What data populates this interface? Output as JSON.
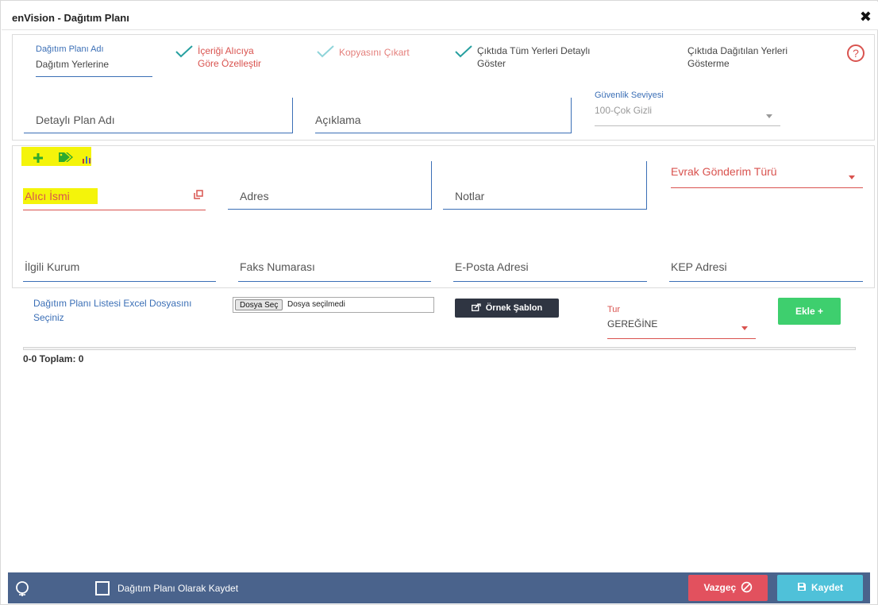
{
  "window": {
    "title": "enVision - Dağıtım Planı"
  },
  "top": {
    "plan_name_label": "Dağıtım Planı Adı",
    "plan_name_value": "Dağıtım Yerlerine",
    "opt1_line1": "İçeriği Alıcıya",
    "opt1_line2": "Göre Özelleştir",
    "opt2": "Kopyasını Çıkart",
    "opt3_line1": "Çıktıda Tüm Yerleri Detaylı",
    "opt3_line2": "Göster",
    "opt4_line1": "Çıktıda Dağıtılan Yerleri",
    "opt4_line2": "Gösterme",
    "help": "?",
    "detail_plan_placeholder": "Detaylı Plan Adı",
    "description_placeholder": "Açıklama",
    "security_label": "Güvenlik Seviyesi",
    "security_value": "100-Çok Gizli"
  },
  "recipient": {
    "name_placeholder": "Alıcı İsmi",
    "address_placeholder": "Adres",
    "notes_placeholder": "Notlar",
    "send_type_placeholder": "Evrak Gönderim Türü",
    "institution_placeholder": "İlgili Kurum",
    "fax_placeholder": "Faks Numarası",
    "email_placeholder": "E-Posta Adresi",
    "kep_placeholder": "KEP Adresi"
  },
  "excel": {
    "label_line1": "Dağıtım Planı Listesi Excel Dosyasını",
    "label_line2": "Seçiniz",
    "file_button": "Dosya Seç",
    "file_status": "Dosya seçilmedi",
    "template_button": "Örnek Şablon",
    "type_label": "Tur",
    "type_value": "GEREĞİNE",
    "add_button": "Ekle +"
  },
  "list": {
    "total": "0-0 Toplam: 0"
  },
  "footer": {
    "save_as_plan": "Dağıtım Planı Olarak Kaydet",
    "cancel": "Vazgeç",
    "save": "Kaydet"
  },
  "colors": {
    "accent_blue": "#3b6fb6",
    "red": "#d9534f",
    "footer_bg": "#4a638c",
    "green": "#3ecf6e",
    "cancel": "#e2515e",
    "save": "#4fc1d9"
  }
}
